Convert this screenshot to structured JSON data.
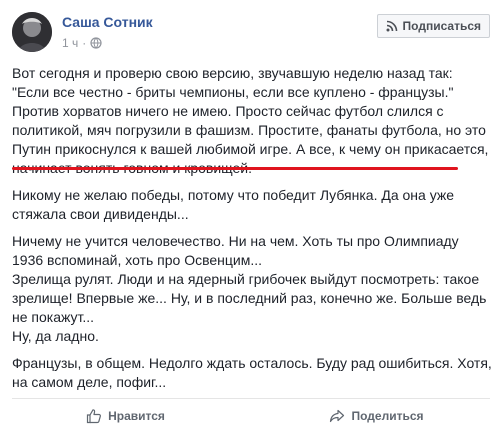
{
  "author": {
    "name": "Саша Сотник",
    "time": "1 ч"
  },
  "subscribe_label": "Подписаться",
  "post": {
    "p1_line1": "Вот сегодня и проверю свою версию, звучавшую неделю назад так:",
    "p1_quote": "\"Если все честно - бриты чемпионы, если все куплено - французы.\"",
    "p1_rest": "Против хорватов ничего не имею. Просто сейчас футбол слился с политикой, мяч погрузили в фашизм. Простите, фанаты футбола, но это Путин прикоснулся к вашей любимой игре. А все, к чему он прикасается, начинает вонять говном и кровищей.",
    "p2": "Никому не желаю победы, потому что победит Лубянка. Да она уже стяжала свои дивиденды...",
    "p3": "Ничему не учится человечество. Ни на чем. Хоть ты про Олимпиаду 1936 вспоминай, хоть про Освенцим...",
    "p4": "Зрелища рулят. Люди и на ядерный грибочек выйдут посмотреть: такое зрелище! Впервые же... Ну, и в последний раз, конечно же. Больше ведь не покажут...",
    "p5": "Ну, да ладно.",
    "p6": "Французы, в общем. Недолго ждать осталось. Буду рад ошибиться. Хотя, на самом деле, пофиг..."
  },
  "actions": {
    "like_label": "Нравится",
    "share_label": "Поделиться"
  },
  "colors": {
    "link": "#365899",
    "underline": "#e0141e",
    "muted": "#90949c"
  }
}
